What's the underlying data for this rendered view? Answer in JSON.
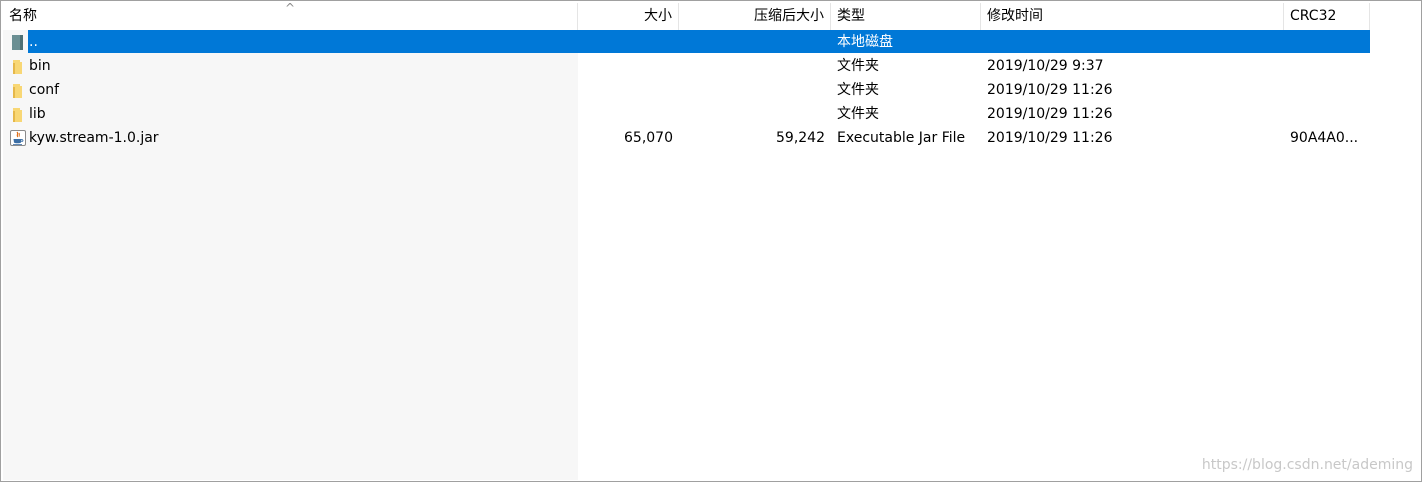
{
  "columns": {
    "name": "名称",
    "size": "大小",
    "packed": "压缩后大小",
    "type": "类型",
    "modified": "修改时间",
    "crc": "CRC32",
    "sort_indicator": "^"
  },
  "rows": [
    {
      "name": "..",
      "size": "",
      "packed": "",
      "type": "本地磁盘",
      "modified": "",
      "crc": "",
      "icon": "parent-folder-icon",
      "selected": true
    },
    {
      "name": "bin",
      "size": "",
      "packed": "",
      "type": "文件夹",
      "modified": "2019/10/29 9:37",
      "crc": "",
      "icon": "folder-icon"
    },
    {
      "name": "conf",
      "size": "",
      "packed": "",
      "type": "文件夹",
      "modified": "2019/10/29 11:26",
      "crc": "",
      "icon": "folder-icon"
    },
    {
      "name": "lib",
      "size": "",
      "packed": "",
      "type": "文件夹",
      "modified": "2019/10/29 11:26",
      "crc": "",
      "icon": "folder-icon"
    },
    {
      "name": "kyw.stream-1.0.jar",
      "size": "65,070",
      "packed": "59,242",
      "type": "Executable Jar File",
      "modified": "2019/10/29 11:26",
      "crc": "90A4A0...",
      "icon": "java-jar-icon"
    }
  ],
  "colors": {
    "selection": "#0078d7",
    "folder": "#f8d775",
    "name_column_bg": "#f7f7f7"
  },
  "watermark": "https://blog.csdn.net/ademing"
}
